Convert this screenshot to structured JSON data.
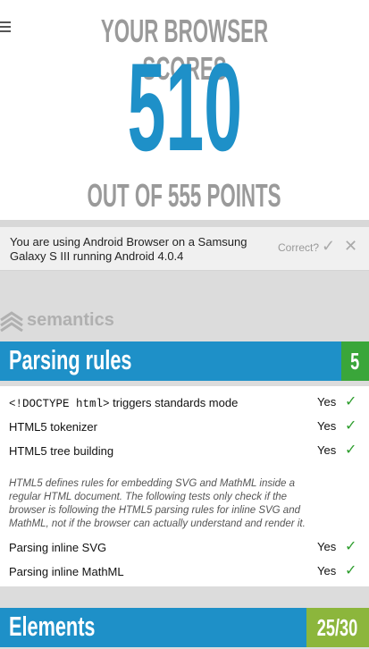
{
  "score_panel": {
    "headline": "YOUR BROWSER SCORES",
    "score": "510",
    "points": "OUT OF 555 POINTS"
  },
  "browser_info": {
    "text": "You are using Android Browser on a Samsung Galaxy S III running Android 4.0.4",
    "correct_label": "Correct?",
    "confirm_icon": "check-icon",
    "reject_icon": "close-icon"
  },
  "section": {
    "title": "semantics",
    "icon": "semantics-logo-icon"
  },
  "categories": [
    {
      "title": "Parsing rules",
      "score": "5",
      "tests": [
        {
          "name_code": "<!DOCTYPE html>",
          "name": " triggers standards mode",
          "result": "Yes"
        },
        {
          "name": "HTML5 tokenizer",
          "result": "Yes"
        },
        {
          "name": "HTML5 tree building",
          "result": "Yes"
        },
        {
          "name": "Parsing inline SVG",
          "result": "Yes"
        },
        {
          "name": "Parsing inline MathML",
          "result": "Yes"
        }
      ],
      "note": "HTML5 defines rules for embedding SVG and MathML inside a regular HTML document. The following tests only check if the browser is following the HTML5 parsing rules for inline SVG and MathML, not if the browser can actually understand and render it."
    },
    {
      "title": "Elements",
      "score": "25/30"
    }
  ],
  "colors": {
    "accent": "#1e90c8",
    "full_score": "#3aa63a",
    "partial_score": "#8cb63c",
    "pass": "#2e9e2e"
  }
}
